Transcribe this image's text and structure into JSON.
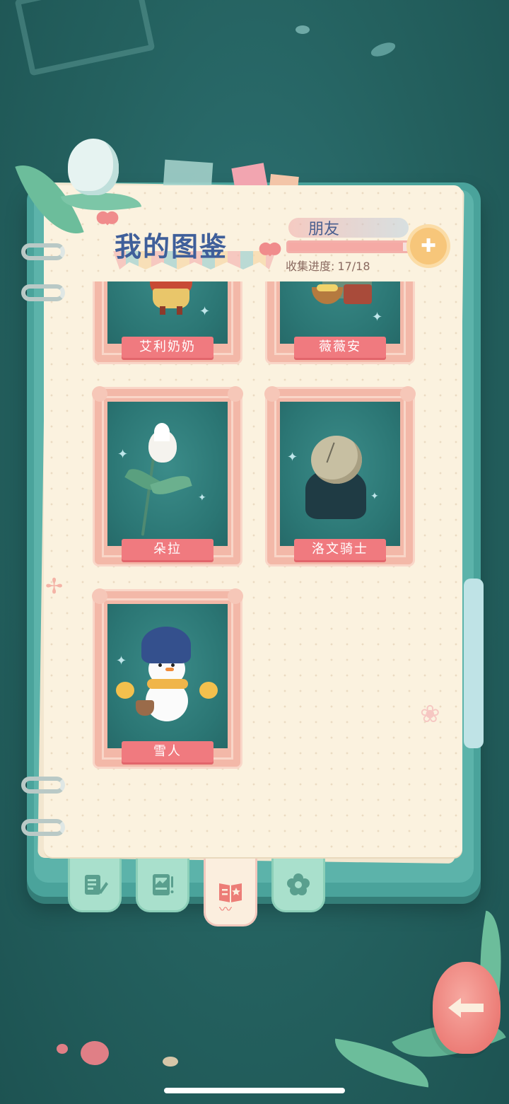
{
  "header": {
    "title": "我的图鉴",
    "level_label": "朋友",
    "progress_label": "收集进度:",
    "progress_count": "17/18",
    "progress_fraction": 0.944
  },
  "cards": [
    {
      "name": "艾利奶奶"
    },
    {
      "name": "薇薇安"
    },
    {
      "name": "朵拉"
    },
    {
      "name": "洛文骑士"
    },
    {
      "name": "雪人"
    }
  ],
  "tabs": [
    {
      "icon": "notebook-pencil-icon"
    },
    {
      "icon": "photo-album-icon"
    },
    {
      "icon": "book-star-icon",
      "active": true
    },
    {
      "icon": "flower-icon"
    }
  ],
  "colors": {
    "background": "#24615f",
    "binder": "#4aa39b",
    "paper": "#fbf2df",
    "frame": "#f3b8a8",
    "label": "#f07a7f",
    "title": "#3f5f9a",
    "back_button": "#ec7d77"
  },
  "back_button": {
    "icon": "back-arrow-icon"
  }
}
